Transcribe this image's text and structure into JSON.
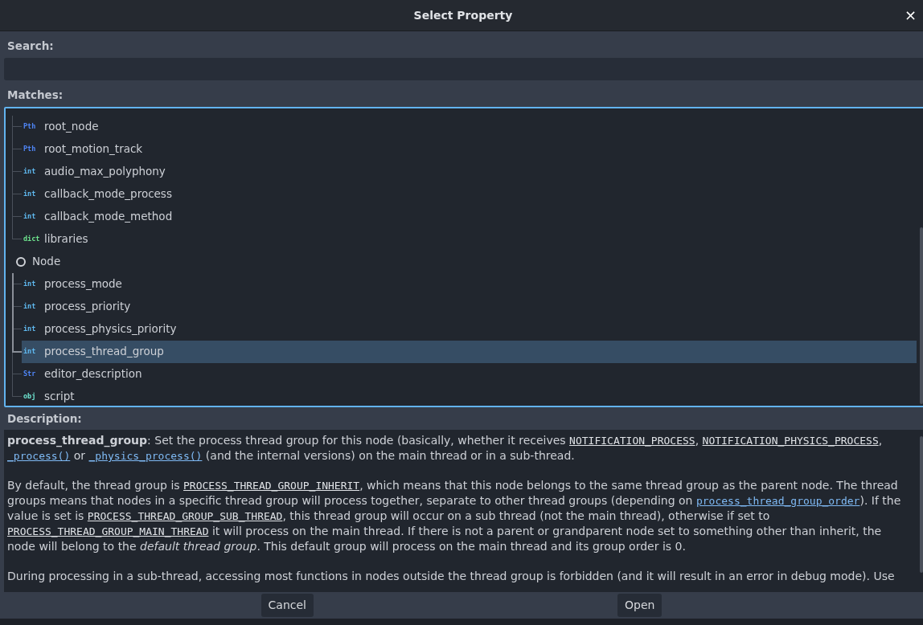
{
  "window": {
    "title": "Select Property",
    "close": "×"
  },
  "search": {
    "label": "Search:"
  },
  "matches": {
    "label": "Matches:",
    "groups": [
      {
        "children": [
          {
            "type": "Pth",
            "color": "#4f86f7",
            "label": "root_node",
            "selected": false
          },
          {
            "type": "Pth",
            "color": "#4f86f7",
            "label": "root_motion_track",
            "selected": false
          },
          {
            "type": "int",
            "color": "#5fb9f0",
            "label": "audio_max_polyphony",
            "selected": false
          },
          {
            "type": "int",
            "color": "#5fb9f0",
            "label": "callback_mode_process",
            "selected": false
          },
          {
            "type": "int",
            "color": "#5fb9f0",
            "label": "callback_mode_method",
            "selected": false
          },
          {
            "type": "dict",
            "color": "#6ee48e",
            "label": "libraries",
            "selected": false
          }
        ]
      },
      {
        "label": "Node",
        "children": [
          {
            "type": "int",
            "color": "#5fb9f0",
            "label": "process_mode",
            "selected": false
          },
          {
            "type": "int",
            "color": "#5fb9f0",
            "label": "process_priority",
            "selected": false
          },
          {
            "type": "int",
            "color": "#5fb9f0",
            "label": "process_physics_priority",
            "selected": false
          },
          {
            "type": "int",
            "color": "#5fb9f0",
            "label": "process_thread_group",
            "selected": true
          },
          {
            "type": "Str",
            "color": "#4f86f7",
            "label": "editor_description",
            "selected": false
          },
          {
            "type": "obj",
            "color": "#6ee4d0",
            "label": "script",
            "selected": false
          }
        ]
      }
    ]
  },
  "description": {
    "label": "Description:",
    "paragraphs": [
      [
        {
          "kind": "bold",
          "text": "process_thread_group"
        },
        {
          "kind": "plain",
          "text": ": Set the process thread group for this node (basically, whether it receives "
        },
        {
          "kind": "code",
          "text": "NOTIFICATION_PROCESS"
        },
        {
          "kind": "plain",
          "text": ", "
        },
        {
          "kind": "code",
          "text": "NOTIFICATION_PHYSICS_PROCESS"
        },
        {
          "kind": "plain",
          "text": ", "
        },
        {
          "kind": "link",
          "text": "_process()"
        },
        {
          "kind": "plain",
          "text": " or "
        },
        {
          "kind": "link",
          "text": "_physics_process()"
        },
        {
          "kind": "plain",
          "text": " (and the internal versions) on the main thread or in a sub-thread."
        }
      ],
      [
        {
          "kind": "plain",
          "text": "By default, the thread group is "
        },
        {
          "kind": "code",
          "text": "PROCESS_THREAD_GROUP_INHERIT"
        },
        {
          "kind": "plain",
          "text": ", which means that this node belongs to the same thread group as the parent node. The thread groups means that nodes in a specific thread group will process together, separate to other thread groups (depending on "
        },
        {
          "kind": "link",
          "text": "process_thread_group_order"
        },
        {
          "kind": "plain",
          "text": "). If the value is set is "
        },
        {
          "kind": "code",
          "text": "PROCESS_THREAD_GROUP_SUB_THREAD"
        },
        {
          "kind": "plain",
          "text": ", this thread group will occur on a sub thread (not the main thread), otherwise if set to "
        },
        {
          "kind": "code",
          "text": "PROCESS_THREAD_GROUP_MAIN_THREAD"
        },
        {
          "kind": "plain",
          "text": " it will process on the main thread. If there is not a parent or grandparent node set to something other than inherit, the node will belong to the "
        },
        {
          "kind": "italic",
          "text": "default thread group"
        },
        {
          "kind": "plain",
          "text": ". This default group will process on the main thread and its group order is 0."
        }
      ],
      [
        {
          "kind": "plain",
          "text": "During processing in a sub-thread, accessing most functions in nodes outside the thread group is forbidden (and it will result in an error in debug mode). Use"
        }
      ]
    ]
  },
  "buttons": [
    "Cancel",
    "Open"
  ]
}
